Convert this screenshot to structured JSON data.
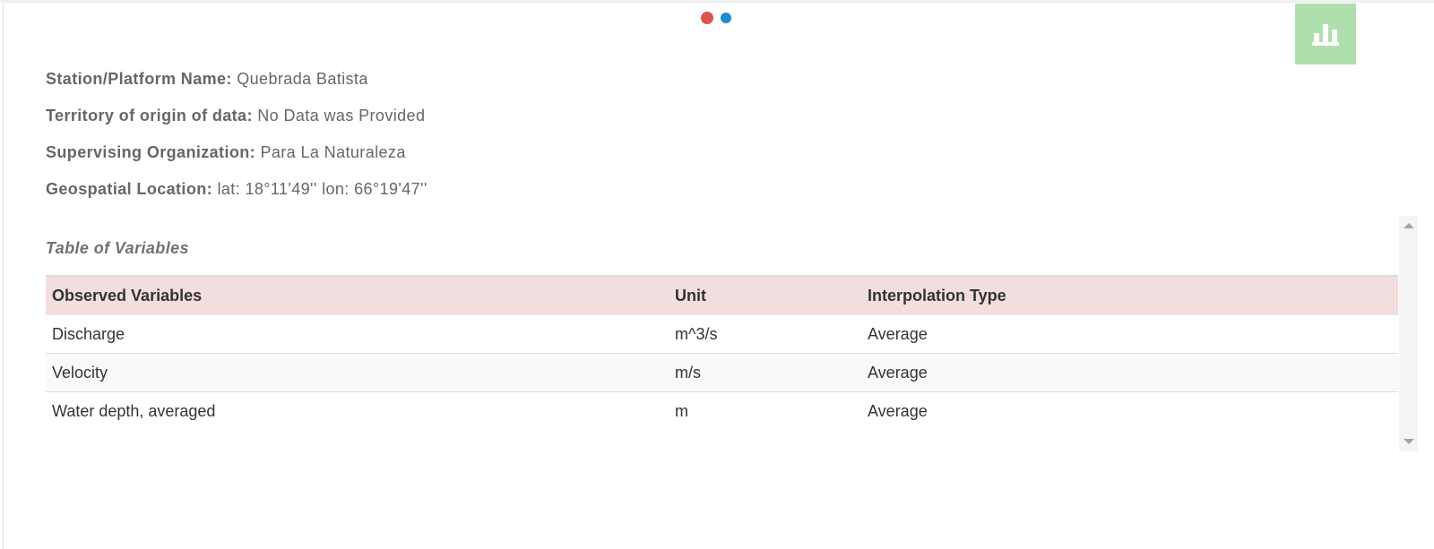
{
  "indicators": {
    "dot_colors": [
      "#d9534f",
      "#1e8bd1"
    ]
  },
  "chart_button": {
    "icon": "bar-chart-icon",
    "bg_color": "#b0dfae"
  },
  "station": {
    "name_label": "Station/Platform Name:",
    "name_value": "Quebrada Batista",
    "territory_label": "Territory of origin of data:",
    "territory_value": "No Data was Provided",
    "organization_label": "Supervising Organization:",
    "organization_value": "Para La Naturaleza",
    "location_label": "Geospatial Location:",
    "location_value": "lat: 18°11'49'' lon: 66°19'47''"
  },
  "variables_table": {
    "title": "Table of Variables",
    "headers": [
      "Observed Variables",
      "Unit",
      "Interpolation Type"
    ],
    "rows": [
      [
        "Discharge",
        "m^3/s",
        "Average"
      ],
      [
        "Velocity",
        "m/s",
        "Average"
      ],
      [
        "Water depth, averaged",
        "m",
        "Average"
      ]
    ],
    "header_bg": "#f2dede"
  }
}
